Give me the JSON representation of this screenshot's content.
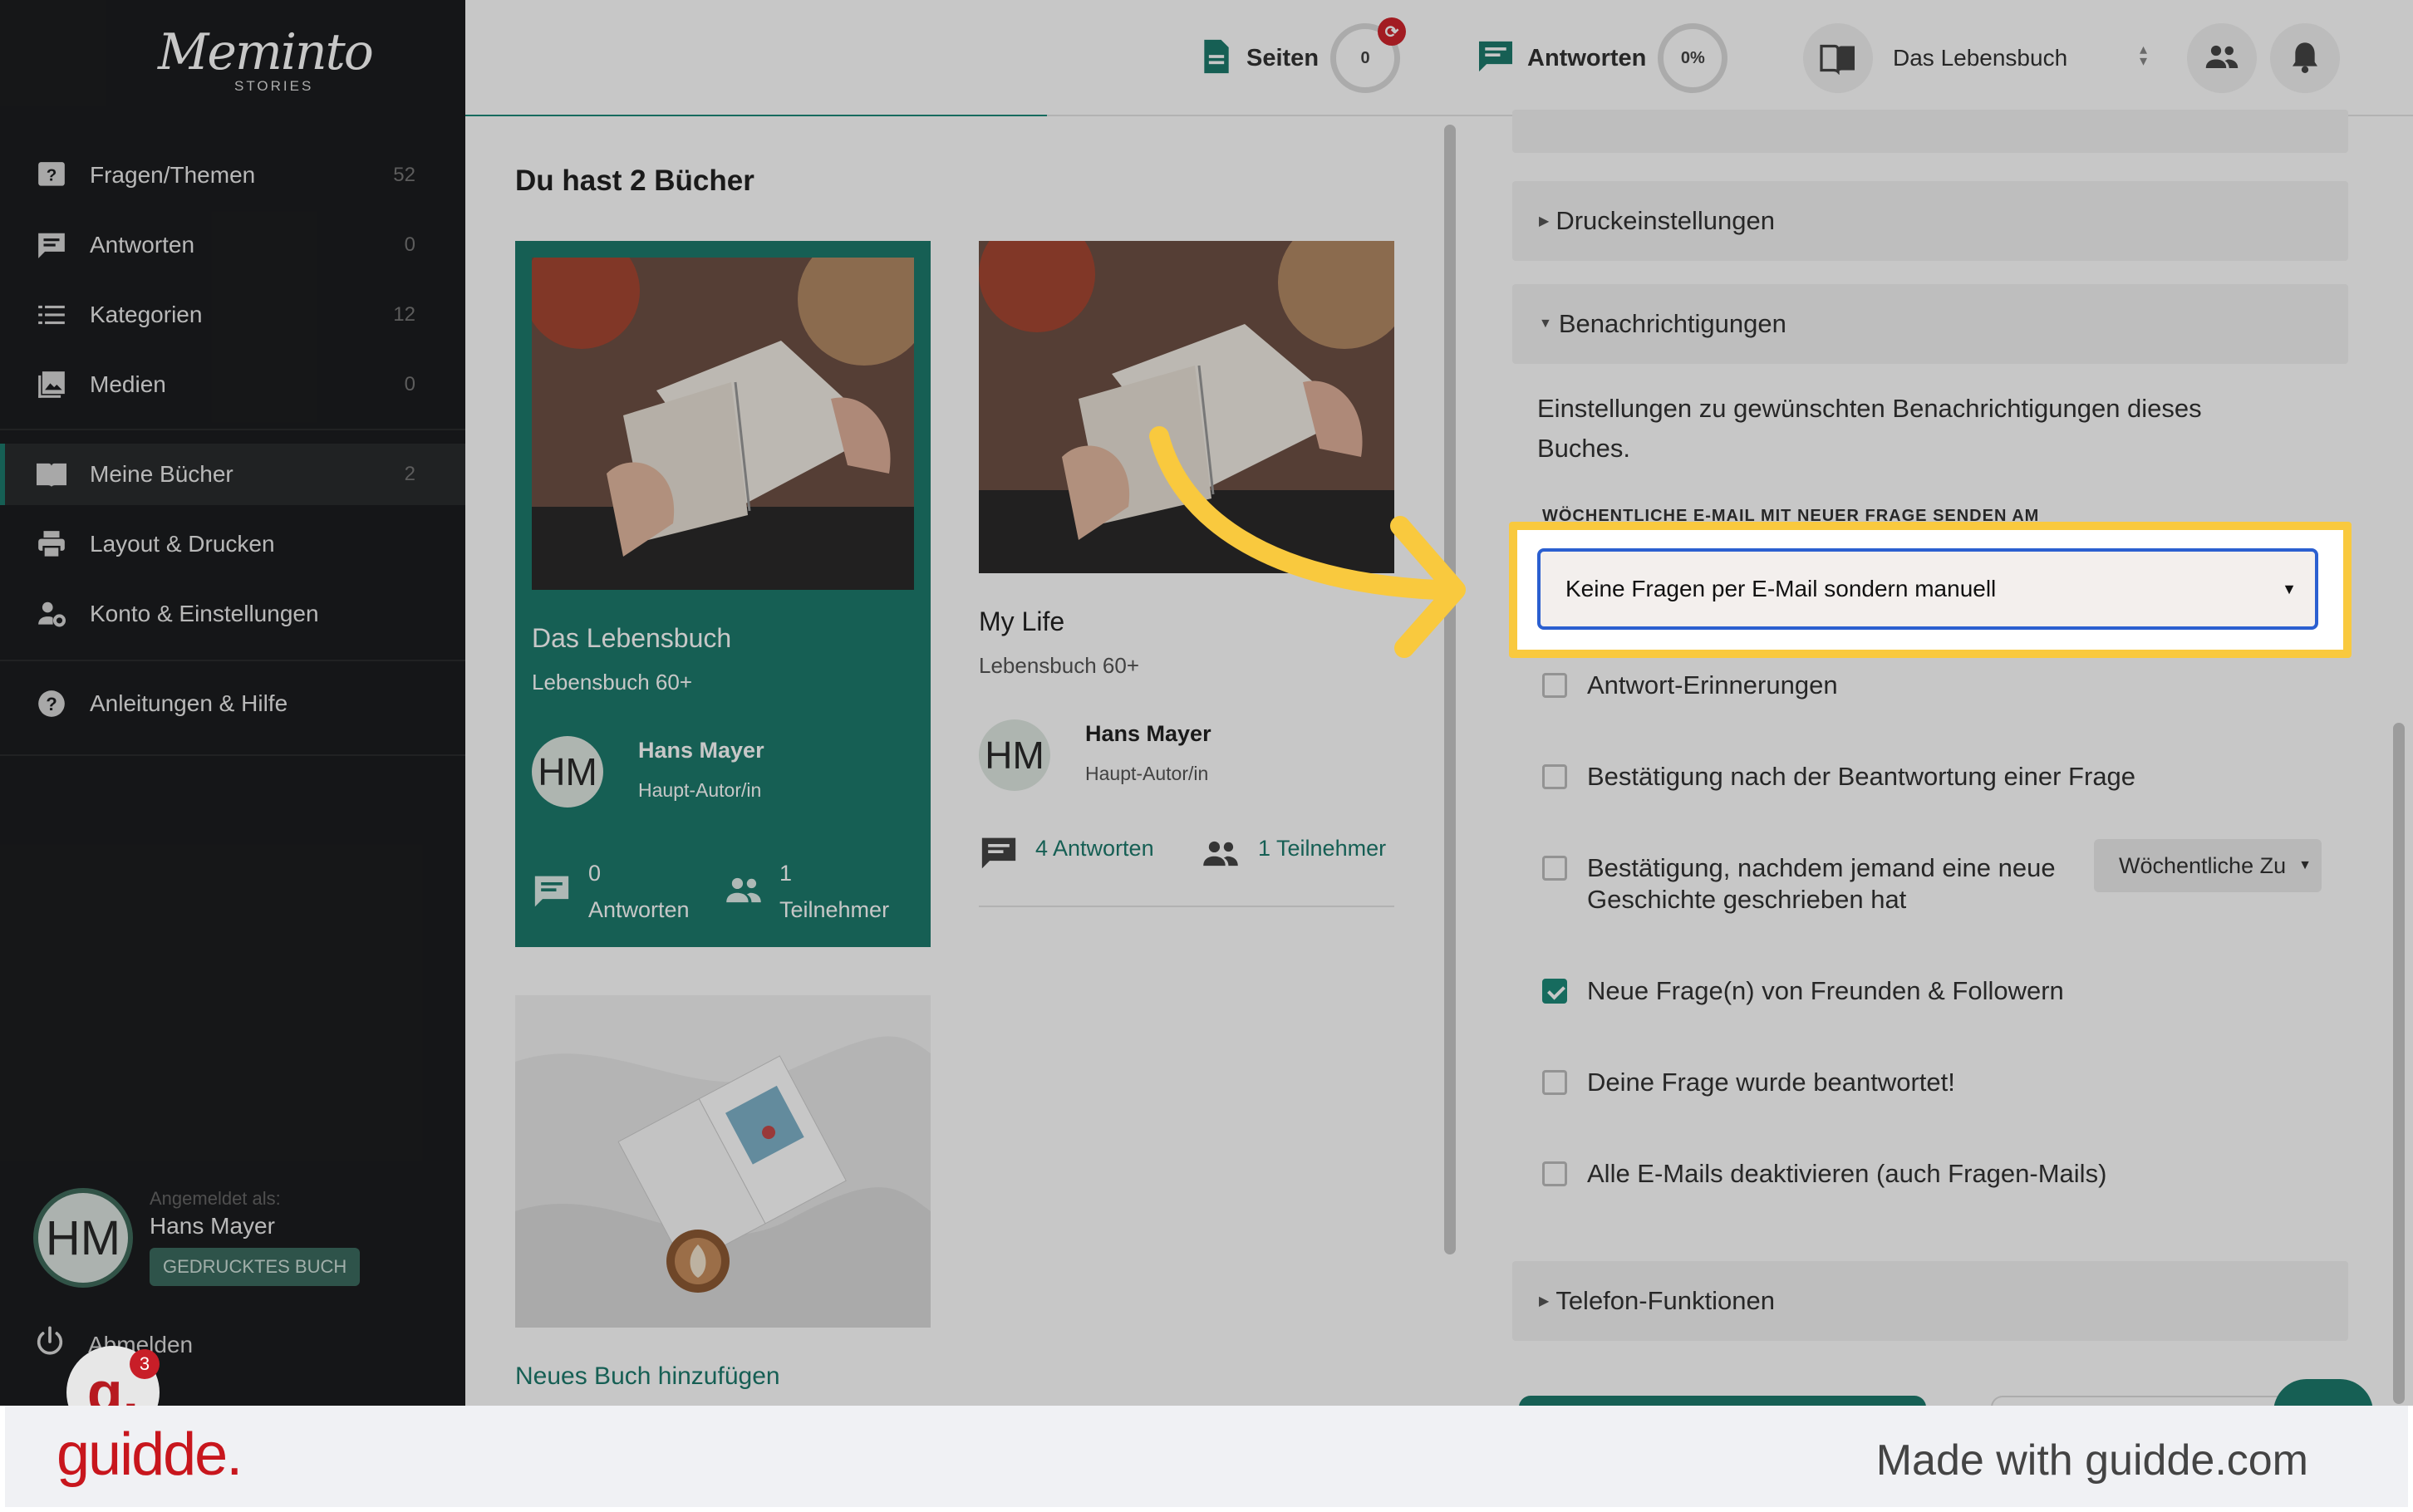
{
  "brand": {
    "logo_text": "Meminto",
    "logo_sub": "STORIES"
  },
  "sidebar": {
    "items": [
      {
        "label": "Fragen/Themen",
        "count": "52",
        "icon": "question-icon"
      },
      {
        "label": "Antworten",
        "count": "0",
        "icon": "comment-icon"
      },
      {
        "label": "Kategorien",
        "count": "12",
        "icon": "list-icon"
      },
      {
        "label": "Medien",
        "count": "0",
        "icon": "image-icon"
      },
      {
        "label": "Meine Bücher",
        "count": "2",
        "icon": "book-icon",
        "active": true
      },
      {
        "label": "Layout & Drucken",
        "icon": "printer-icon"
      },
      {
        "label": "Konto & Einstellungen",
        "icon": "user-settings-icon"
      },
      {
        "label": "Anleitungen & Hilfe",
        "icon": "help-icon"
      }
    ],
    "user": {
      "logged_as": "Angemeldet als:",
      "initials": "HM",
      "name": "Hans Mayer",
      "badge": "GEDRUCKTES BUCH"
    },
    "logout": "Abmelden",
    "guidde_badge": "3"
  },
  "header": {
    "pages_label": "Seiten",
    "pages_count": "0",
    "answers_label": "Antworten",
    "answers_percent": "0%",
    "book_selected": "Das Lebensbuch"
  },
  "books": {
    "title": "Du hast 2 Bücher",
    "cards": [
      {
        "title": "Das Lebensbuch",
        "subtitle": "Lebensbuch 60+",
        "initials": "HM",
        "author": "Hans Mayer",
        "role": "Haupt-Autor/in",
        "answers_count": "0",
        "answers_label": "Antworten",
        "participants_count": "1",
        "participants_label": "Teilnehmer"
      },
      {
        "title": "My Life",
        "subtitle": "Lebensbuch 60+",
        "initials": "HM",
        "author": "Hans Mayer",
        "role": "Haupt-Autor/in",
        "answers_text": "4 Antworten",
        "participants_text": "1 Teilnehmer"
      }
    ],
    "add_book": "Neues Buch hinzufügen"
  },
  "settings": {
    "sections": {
      "print": "Druckeinstellungen",
      "notifications": "Benachrichtigungen",
      "phone": "Telefon-Funktionen"
    },
    "description": "Einstellungen zu gewünschten Benachrichtigungen dieses Buches.",
    "weekly_label": "WÖCHENTLICHE E-MAIL MIT NEUER FRAGE SENDEN AM",
    "weekly_select_value": "Keine Fragen per E-Mail sondern manuell",
    "options": [
      {
        "label": "Antwort-Erinnerungen",
        "checked": false
      },
      {
        "label": "Bestätigung nach der Beantwortung einer Frage",
        "checked": false
      },
      {
        "label": "Bestätigung, nachdem jemand eine neue Geschichte geschrieben hat",
        "checked": false
      },
      {
        "label": "Neue Frage(n) von Freunden & Followern",
        "checked": true
      },
      {
        "label": "Deine Frage wurde beantwortet!",
        "checked": false
      },
      {
        "label": "Alle E-Mails deaktivieren (auch Fragen-Mails)",
        "checked": false
      }
    ],
    "frequency_select": "Wöchentliche Zu",
    "accent_color": "#1d7a6c",
    "highlight_color": "#f9c93e"
  },
  "footer": {
    "logo": "guidde.",
    "text": "Made with guidde.com"
  }
}
